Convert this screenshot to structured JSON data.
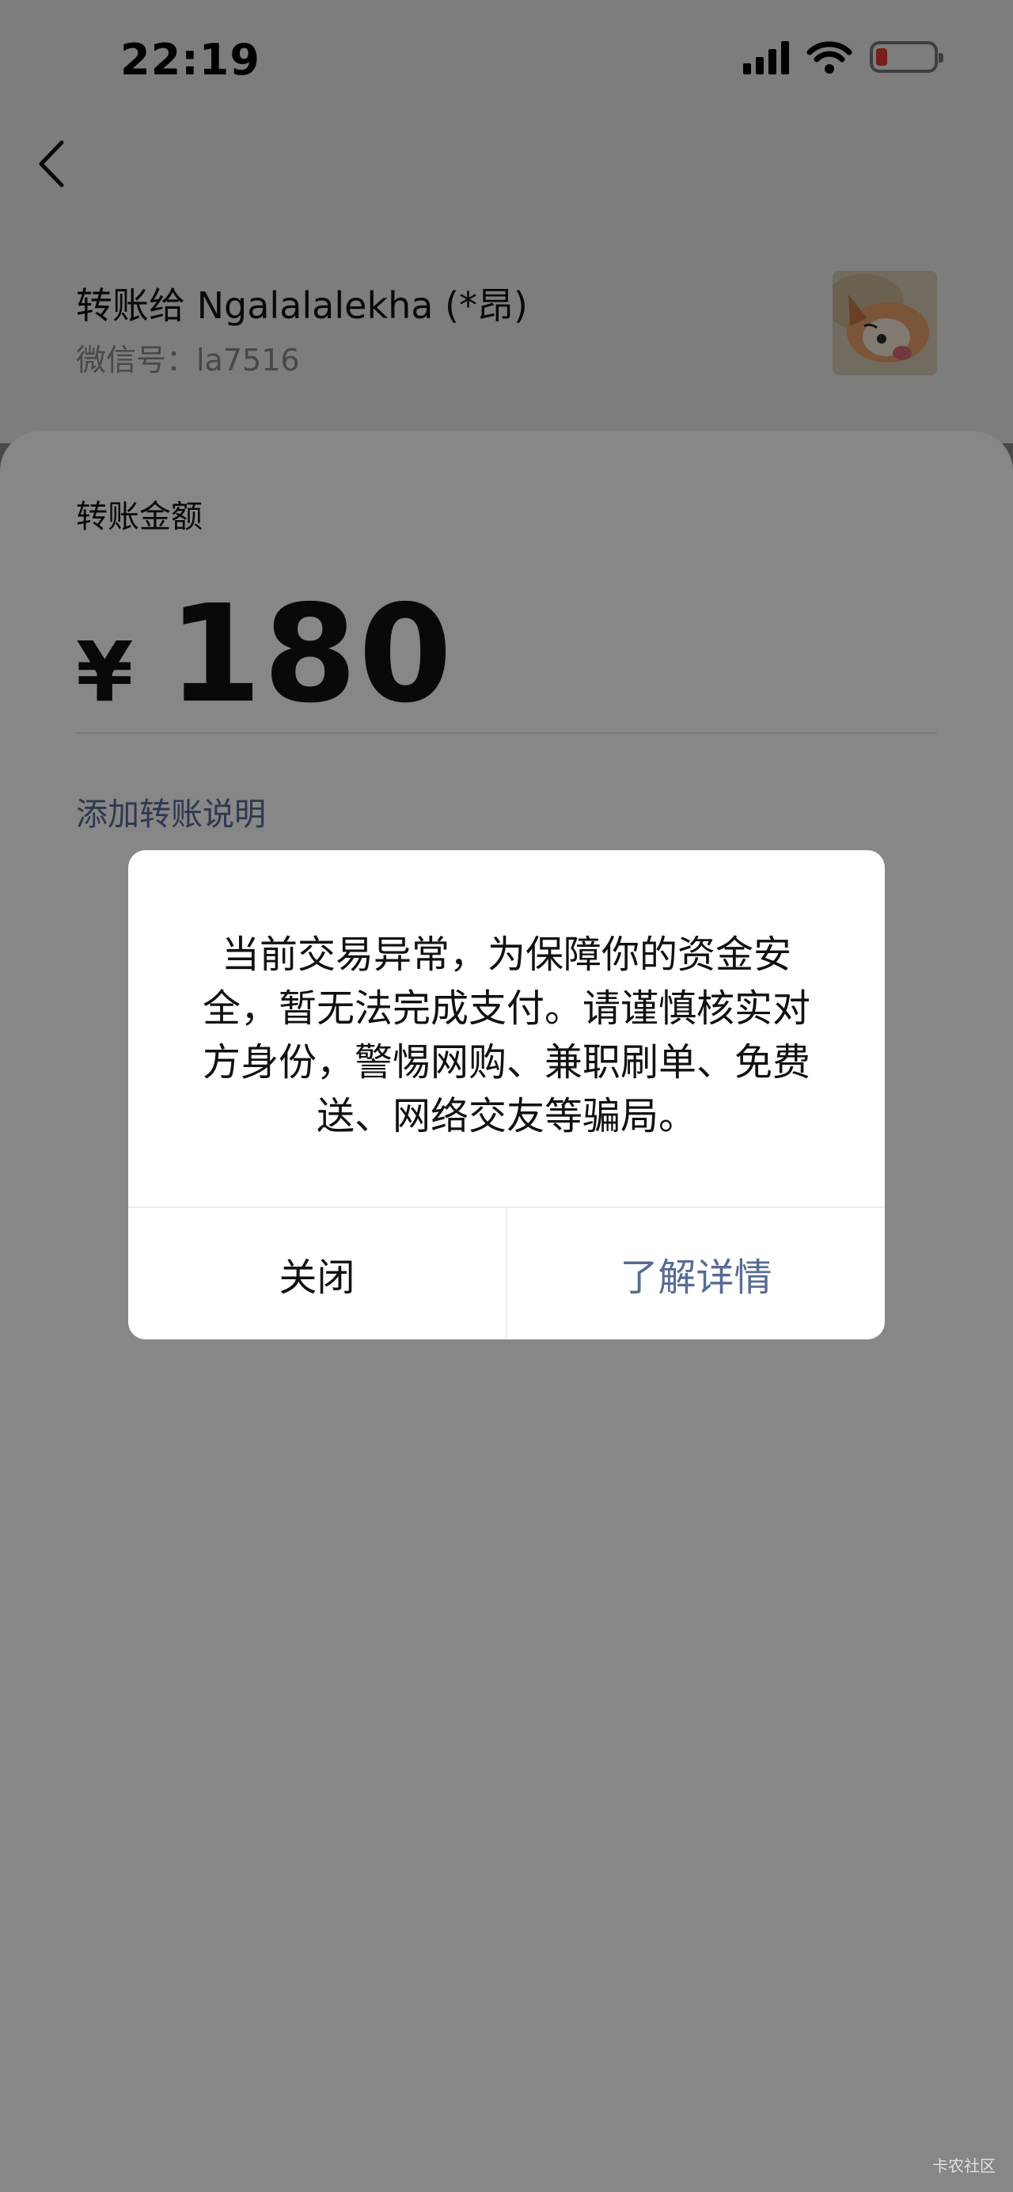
{
  "status_bar": {
    "time": "22:19"
  },
  "header": {
    "back_icon": "chevron-left-icon"
  },
  "recipient": {
    "line": "转账给 Ngalalalekha (*昂)",
    "wechat_id": "微信号：la7516"
  },
  "transfer": {
    "amount_label": "转账金额",
    "currency": "¥",
    "amount": "180",
    "add_note": "添加转账说明"
  },
  "dialog": {
    "message": "当前交易异常，为保障你的资金安全，暂无法完成支付。请谨慎核实对方身份，警惕网购、兼职刷单、免费送、网络交友等骗局。",
    "close_label": "关闭",
    "details_label": "了解详情"
  },
  "watermark": "卡农社区",
  "colors": {
    "link": "#576b95",
    "battery_low": "#e53935"
  }
}
